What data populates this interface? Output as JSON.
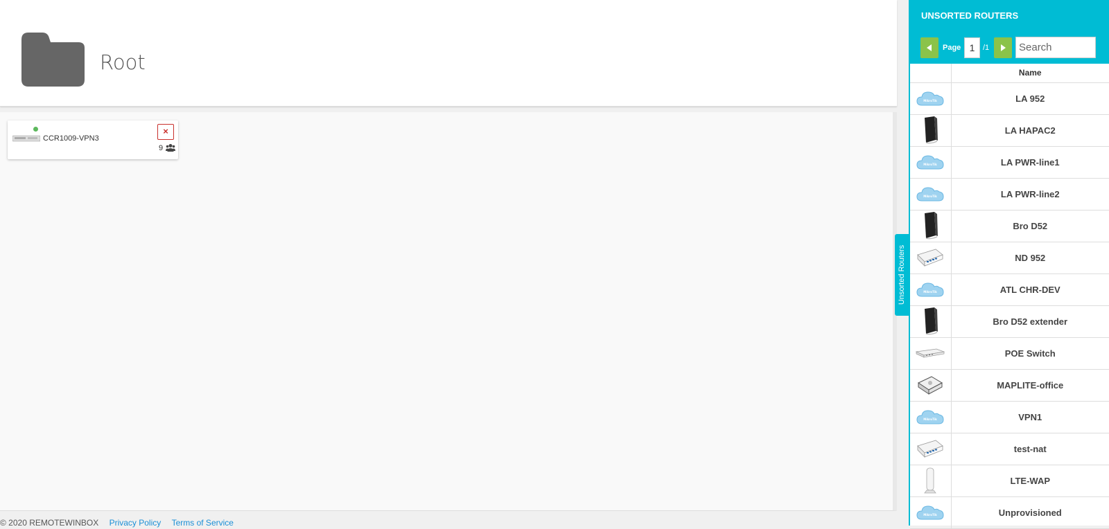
{
  "folder": {
    "title": "Root",
    "icon": "folder-icon"
  },
  "router_card": {
    "name": "CCR1009-VPN3",
    "user_count": "9",
    "remove_label": "×",
    "status": "online",
    "status_color": "#5cb85c"
  },
  "footer": {
    "copyright": "© 2020 REMOTEWINBOX",
    "privacy": "Privacy Policy",
    "terms": "Terms of Service"
  },
  "side_tab": {
    "label": "Unsorted Routers"
  },
  "panel": {
    "title": "UNSORTED ROUTERS",
    "page_label": "Page",
    "page_value": "1",
    "page_total": "/1",
    "search_placeholder": "Search",
    "column_name": "Name",
    "accent_color": "#00bcd4",
    "nav_color": "#8bc34a"
  },
  "routers": [
    {
      "name": "LA 952",
      "icon": "cloud-icon"
    },
    {
      "name": "LA HAPAC2",
      "icon": "black-tower-router-icon"
    },
    {
      "name": "LA PWR-line1",
      "icon": "cloud-icon"
    },
    {
      "name": "LA PWR-line2",
      "icon": "cloud-icon"
    },
    {
      "name": "Bro D52",
      "icon": "black-tower-router-icon"
    },
    {
      "name": "ND 952",
      "icon": "white-box-router-icon"
    },
    {
      "name": "ATL CHR-DEV",
      "icon": "cloud-icon"
    },
    {
      "name": "Bro D52 extender",
      "icon": "black-tower-router-icon"
    },
    {
      "name": "POE Switch",
      "icon": "flat-switch-icon"
    },
    {
      "name": "MAPLITE-office",
      "icon": "maplite-router-icon"
    },
    {
      "name": "VPN1",
      "icon": "cloud-icon"
    },
    {
      "name": "test-nat",
      "icon": "white-box-router-icon"
    },
    {
      "name": "LTE-WAP",
      "icon": "white-tower-router-icon"
    },
    {
      "name": "Unprovisioned",
      "icon": "cloud-icon"
    }
  ]
}
